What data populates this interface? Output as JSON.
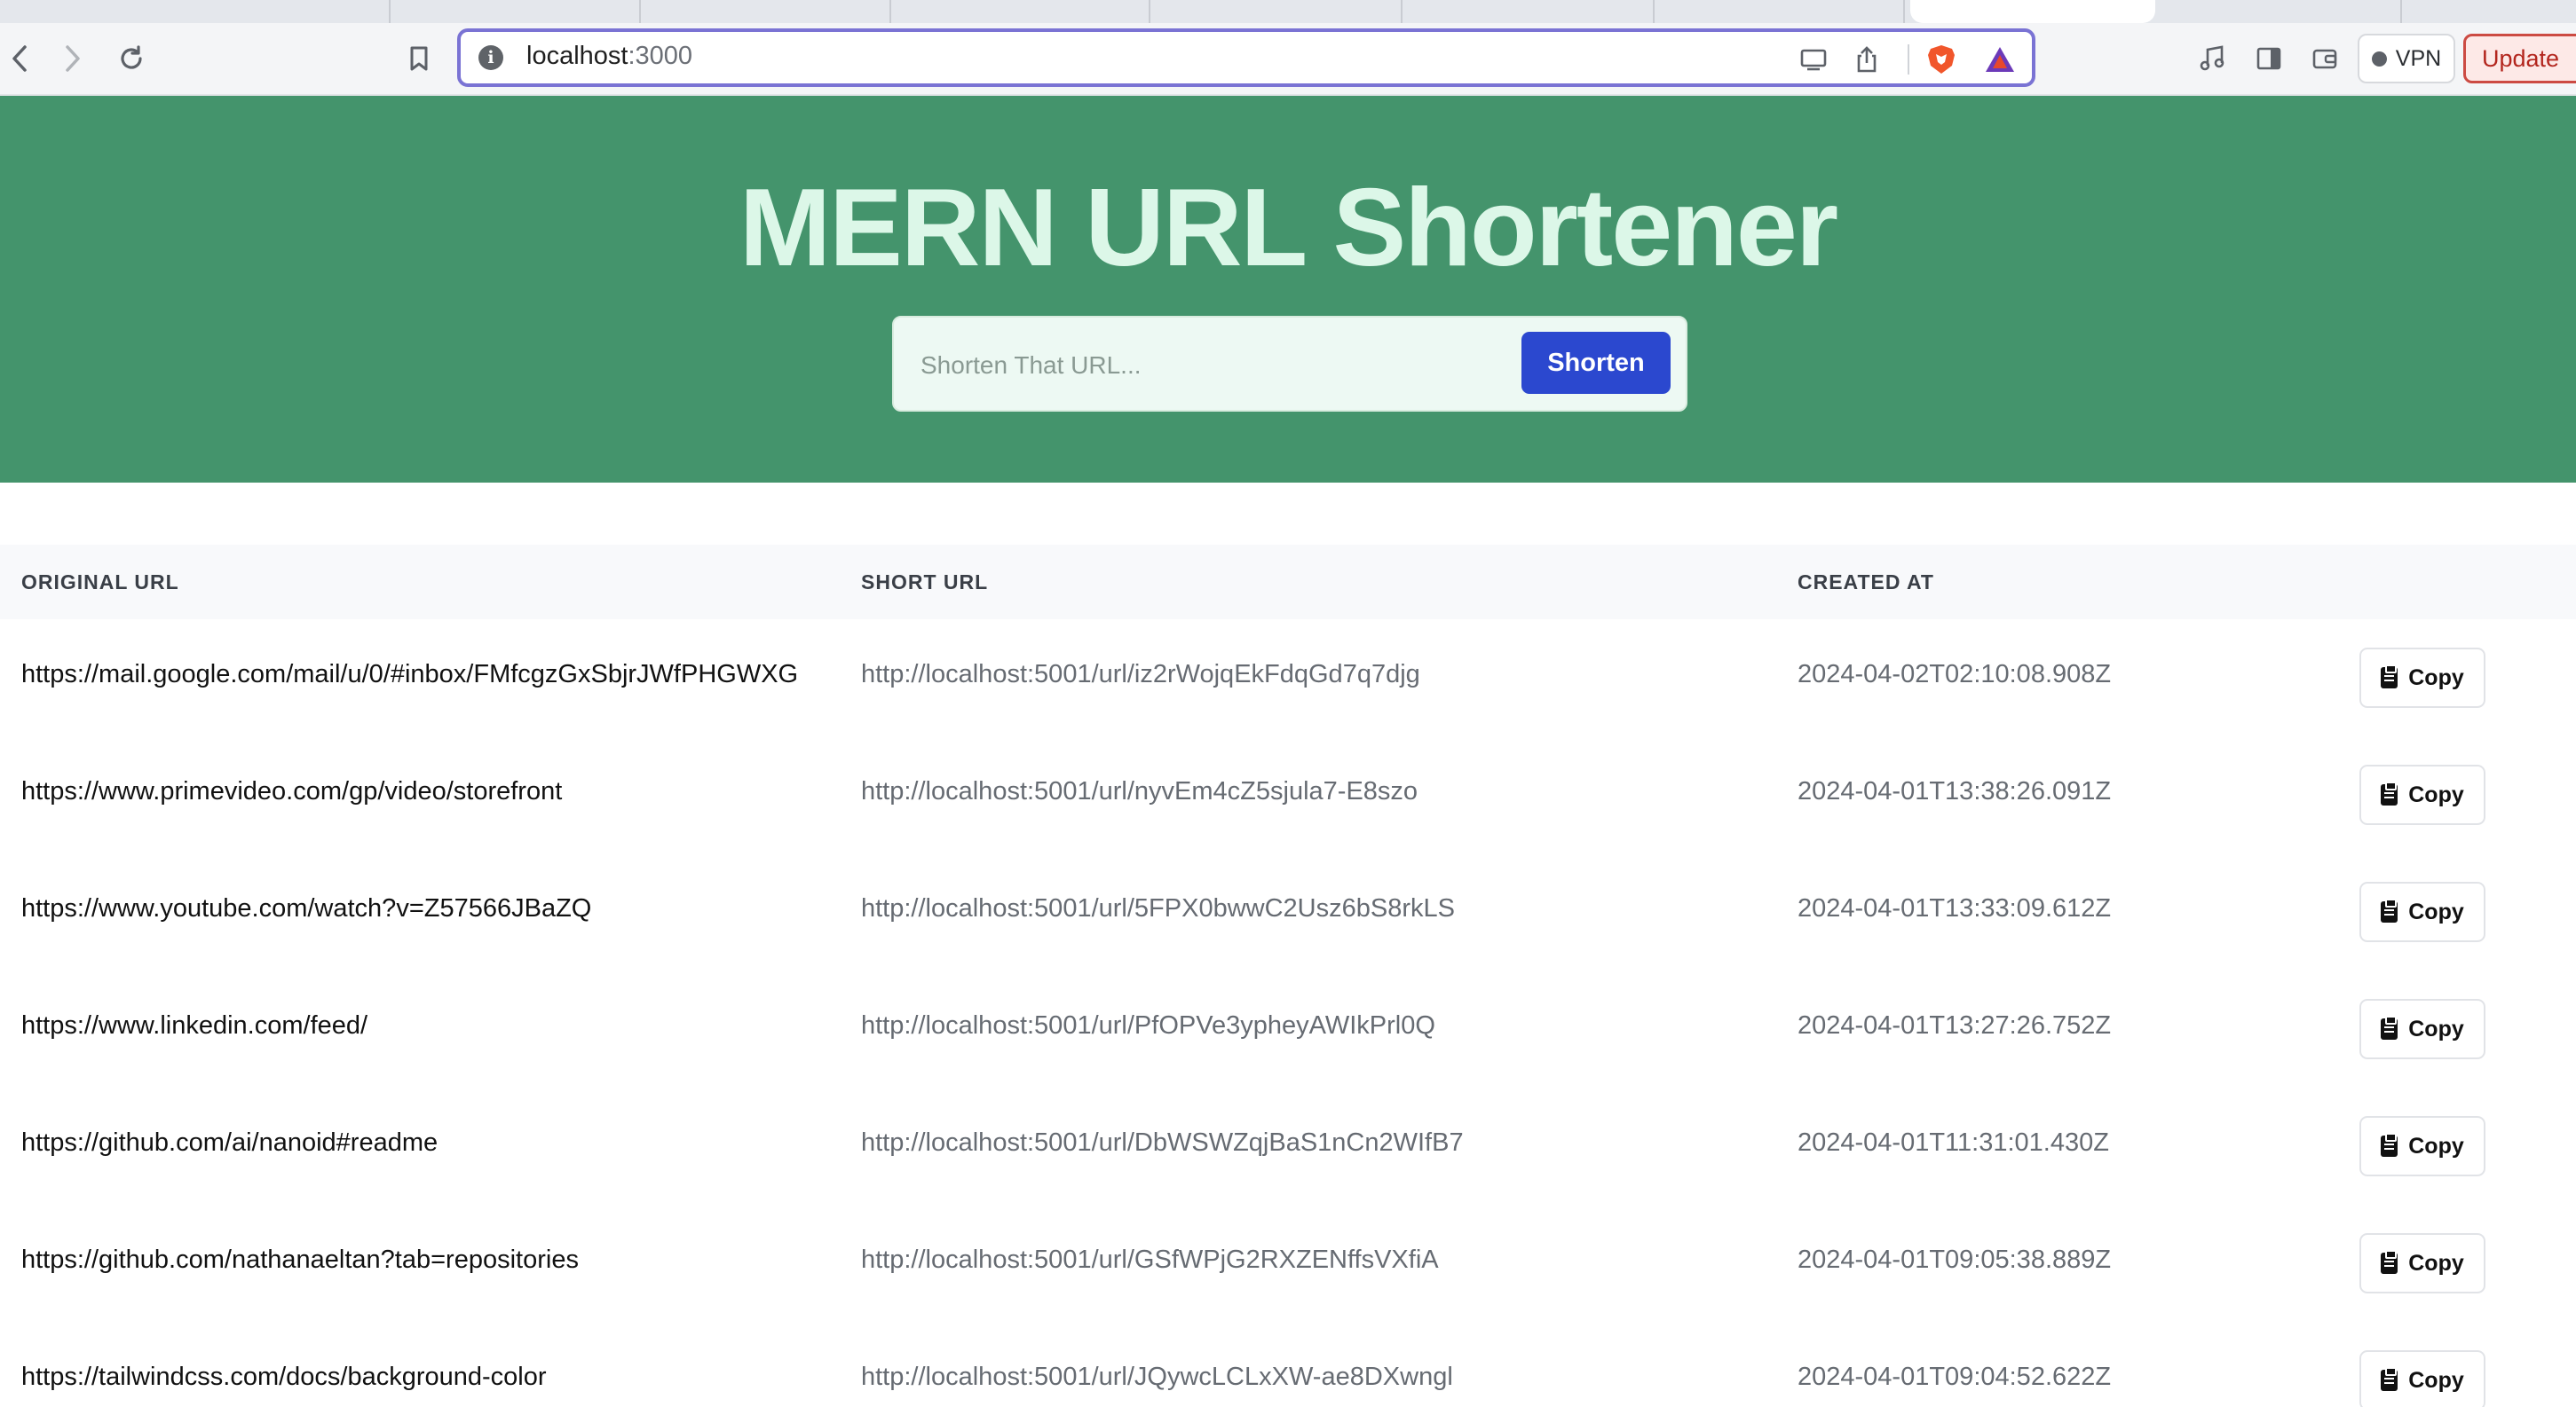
{
  "browser": {
    "address": {
      "host": "localhost",
      "port": ":3000"
    },
    "vpn_label": "VPN",
    "update_label": "Update",
    "icons": {
      "back": "back-arrow-icon",
      "forward": "forward-arrow-icon",
      "reload": "reload-icon",
      "bookmark": "bookmark-icon",
      "site_info": "info-icon",
      "cast": "cast-icon",
      "share": "share-icon",
      "brave": "brave-shield-icon",
      "rewards": "brave-rewards-icon",
      "media": "music-note-icon",
      "sidebar": "sidebar-icon",
      "wallet": "wallet-icon"
    }
  },
  "app": {
    "title": "MERN URL Shortener",
    "input_placeholder": "Shorten That URL...",
    "shorten_label": "Shorten",
    "colors": {
      "hero_bg": "#44946c",
      "title": "#dcf7e8",
      "button": "#2b48cf"
    }
  },
  "table": {
    "headers": {
      "original": "ORIGINAL URL",
      "short": "SHORT URL",
      "created": "CREATED AT"
    },
    "copy_label": "Copy",
    "rows": [
      {
        "original": "https://mail.google.com/mail/u/0/#inbox/FMfcgzGxSbjrJWfPHGWXG",
        "short": "http://localhost:5001/url/iz2rWojqEkFdqGd7q7djg",
        "created": "2024-04-02T02:10:08.908Z"
      },
      {
        "original": "https://www.primevideo.com/gp/video/storefront",
        "short": "http://localhost:5001/url/nyvEm4cZ5sjula7-E8szo",
        "created": "2024-04-01T13:38:26.091Z"
      },
      {
        "original": "https://www.youtube.com/watch?v=Z57566JBaZQ",
        "short": "http://localhost:5001/url/5FPX0bwwC2Usz6bS8rkLS",
        "created": "2024-04-01T13:33:09.612Z"
      },
      {
        "original": "https://www.linkedin.com/feed/",
        "short": "http://localhost:5001/url/PfOPVe3ypheyAWIkPrl0Q",
        "created": "2024-04-01T13:27:26.752Z"
      },
      {
        "original": "https://github.com/ai/nanoid#readme",
        "short": "http://localhost:5001/url/DbWSWZqjBaS1nCn2WIfB7",
        "created": "2024-04-01T11:31:01.430Z"
      },
      {
        "original": "https://github.com/nathanaeltan?tab=repositories",
        "short": "http://localhost:5001/url/GSfWPjG2RXZENffsVXfiA",
        "created": "2024-04-01T09:05:38.889Z"
      },
      {
        "original": "https://tailwindcss.com/docs/background-color",
        "short": "http://localhost:5001/url/JQywcLCLxXW-ae8DXwngl",
        "created": "2024-04-01T09:04:52.622Z"
      }
    ]
  }
}
